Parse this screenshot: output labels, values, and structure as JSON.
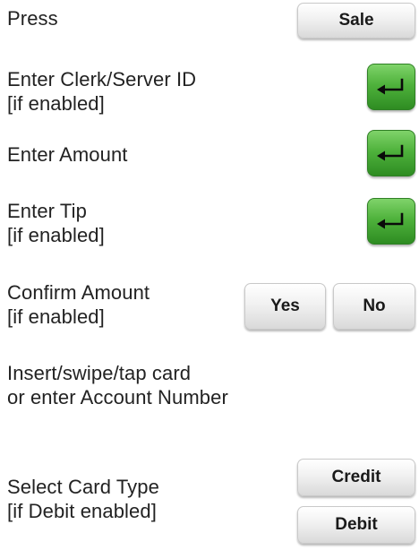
{
  "steps": [
    {
      "lines": [
        "Press"
      ]
    },
    {
      "lines": [
        "Enter Clerk/Server ID",
        "[if enabled]"
      ]
    },
    {
      "lines": [
        "Enter Amount"
      ]
    },
    {
      "lines": [
        "Enter Tip",
        "[if enabled]"
      ]
    },
    {
      "lines": [
        "Confirm Amount",
        "[if enabled]"
      ]
    },
    {
      "lines": [
        "Insert/swipe/tap card",
        "or enter Account Number"
      ]
    },
    {
      "lines": [
        "Select Card Type",
        "[if Debit enabled]"
      ]
    }
  ],
  "buttons": {
    "sale": "Sale",
    "yes": "Yes",
    "no": "No",
    "credit": "Credit",
    "debit": "Debit"
  },
  "icons": {
    "enter": "enter-arrow-icon"
  },
  "colors": {
    "key_green": "#4fb23c",
    "key_gray": "#e6e6e6",
    "text": "#222222"
  }
}
